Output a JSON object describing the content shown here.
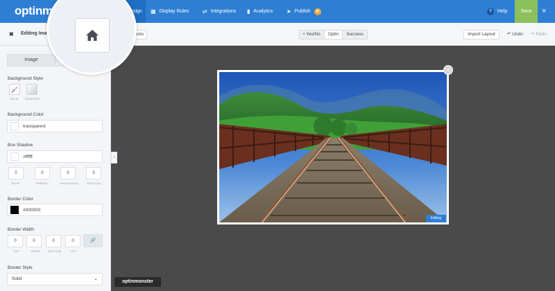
{
  "app": {
    "logo": "optinm",
    "brand_badge": "optinmonster"
  },
  "nav": {
    "design": "Design",
    "display_rules": "Display Rules",
    "integrations": "Integrations",
    "analytics": "Analytics",
    "publish": "Publish",
    "publish_badge": "H",
    "help": "Help",
    "help_icon": "?",
    "save": "Save",
    "close": "×"
  },
  "toolbar": {
    "title": "Editing Imag",
    "blocks": "ocks",
    "views": [
      "Yes/No",
      "Optin",
      "Success"
    ],
    "active_view": "Optin",
    "import_layout": "Import Layout",
    "undo": "Undo",
    "redo": "Redo"
  },
  "sidebar": {
    "tab_image": "Image",
    "background_style_label": "Background Style",
    "solid_label": "SOLID",
    "gradient_label": "GRADIENT",
    "background_color_label": "Background Color",
    "background_color_value": "transparent",
    "box_shadow_label": "Box Shadow",
    "box_shadow_color": "#ffffff",
    "shadow_values": [
      "0",
      "0",
      "0",
      "0"
    ],
    "shadow_labels": [
      "BLUR",
      "SPREAD",
      "HORIZONTAL",
      "VERTICAL"
    ],
    "border_color_label": "Border Color",
    "border_color_value": "#000000",
    "border_width_label": "Border Width",
    "border_values": [
      "0",
      "0",
      "0",
      "0"
    ],
    "border_labels": [
      "TOP",
      "RIGHT",
      "BOTTOM",
      "LEFT"
    ],
    "border_style_label": "Border Style",
    "border_style_value": "Solid"
  },
  "canvas": {
    "editing_label": "Editing",
    "popup_close": "×"
  },
  "colors": {
    "nav_blue": "#2e7fd4",
    "save_green": "#8cc05a",
    "canvas_bg": "#4a4a4a"
  },
  "icons": [
    "home-icon",
    "paintbrush-icon",
    "link-icon",
    "undo-icon",
    "redo-icon",
    "chevron-down-icon"
  ]
}
